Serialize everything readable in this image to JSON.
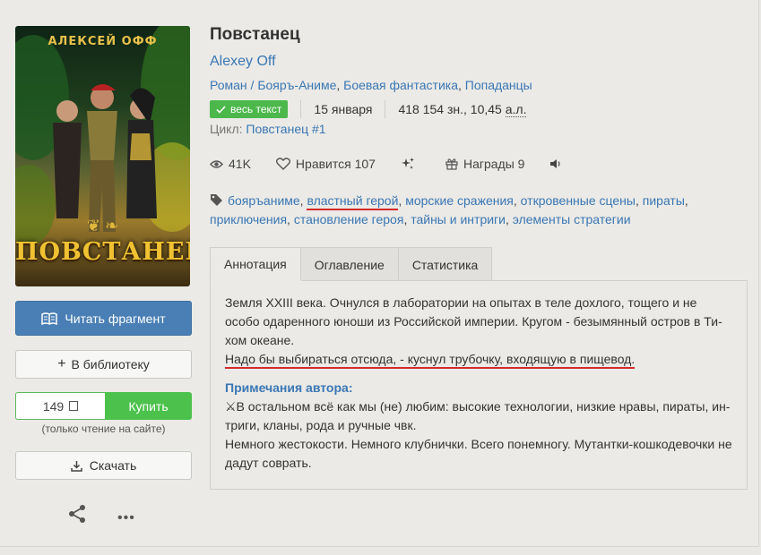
{
  "book": {
    "title": "Повстанец",
    "author": "Alexey Off",
    "genres": [
      "Роман / Бояръ-Аниме",
      "Боевая фантастика",
      "Попаданцы"
    ],
    "badge": "весь текст",
    "date": "15 января",
    "size": "418 154 зн., 10,45",
    "size_unit": "а.л.",
    "cycle_label": "Цикл:",
    "cycle_value": "Повстанец #1"
  },
  "cover": {
    "author_text": "АЛЕКСЕЙ ОФФ",
    "title_text": "ПОВСТАНЕЦ"
  },
  "stats": {
    "views": "41K",
    "likes_label": "Нравится",
    "likes_count": "107",
    "awards_label": "Награды",
    "awards_count": "9"
  },
  "tags": [
    "бояръаниме",
    "властный герой",
    "морские сражения",
    "откровенные сцены",
    "пираты",
    "приключения",
    "становление героя",
    "тайны и интриги",
    "элементы стратегии"
  ],
  "actions": {
    "read_label": "Читать фрагмент",
    "library_label": "В библиотеку",
    "price": "149",
    "buy_label": "Купить",
    "buy_note": "(только чтение на сайте)",
    "download_label": "Скачать"
  },
  "tabs": [
    "Аннотация",
    "Оглавление",
    "Статистика"
  ],
  "annotation": {
    "p1": "Земля XXIII века. Очнулся в лаборатории на опытах в теле дохлого, тощего и не особо одаренного юноши из Российской империи. Кругом - безымянный остров в Ти-хом океане.",
    "p2": "Надо бы выбираться отсюда, - куснул трубочку, входящую в пищевод.",
    "notes_heading": "Примечания автора:",
    "notes1": "⚔В остальном всё как мы (не) любим: высокие технологии, низкие нравы, пираты, ин-триги, кланы, рода и ручные чвк.",
    "notes2": "Немного жестокости. Немного клубнички. Всего понемногу. Мутантки-кошкодевочки не дадут соврать."
  }
}
